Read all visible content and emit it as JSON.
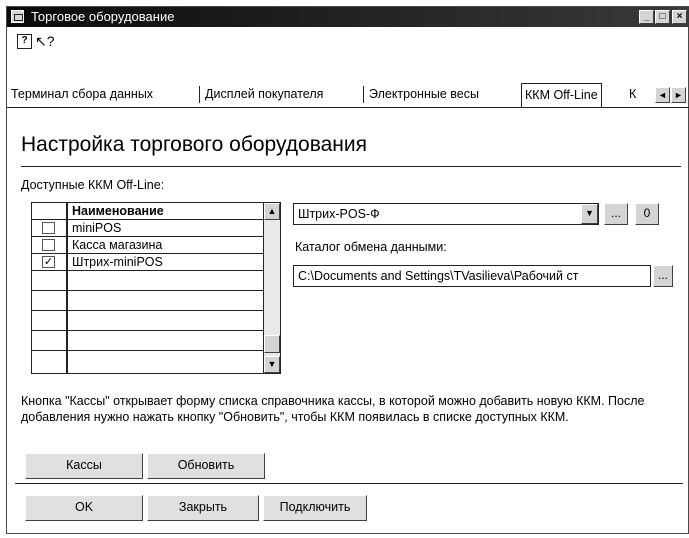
{
  "window": {
    "title": "Торговое оборудование",
    "minimize": "_",
    "maximize": "□",
    "close": "×"
  },
  "toolbar": {
    "help_icon": "?",
    "whats_this_icon": "↖?"
  },
  "tabs": {
    "items": [
      "Терминал сбора данных",
      "Дисплей покупателя",
      "Электронные весы"
    ],
    "active": "ККМ Off-Line",
    "truncated": "К",
    "prev": "◄",
    "next": "►"
  },
  "heading": "Настройка торгового оборудования",
  "available_label": "Доступные ККМ Off-Line:",
  "grid": {
    "column_header": "Наименование",
    "rows": [
      {
        "name": "miniPOS",
        "checked": false
      },
      {
        "name": "Касса магазина",
        "checked": false
      },
      {
        "name": "Штрих-miniPOS",
        "checked": true
      }
    ],
    "check_mark": "✓",
    "scroll_up": "▲",
    "scroll_down": "▼"
  },
  "device_select": {
    "value": "Штрих-POS-Ф",
    "dropdown_arrow": "▼",
    "ellipsis": "...",
    "zero": "0"
  },
  "catalog": {
    "label": "Каталог обмена данными:",
    "value": "C:\\Documents and Settings\\TVasilieva\\Рабочий ст",
    "browse": "..."
  },
  "note": "Кнопка \"Кассы\" открывает форму списка справочника кассы, в которой можно добавить новую ККМ. После добавления нужно нажать кнопку \"Обновить\", чтобы ККМ появилась в списке доступных ККМ.",
  "buttons": {
    "kassy": "Кассы",
    "refresh": "Обновить",
    "ok": "OK",
    "close": "Закрыть",
    "connect": "Подключить"
  }
}
